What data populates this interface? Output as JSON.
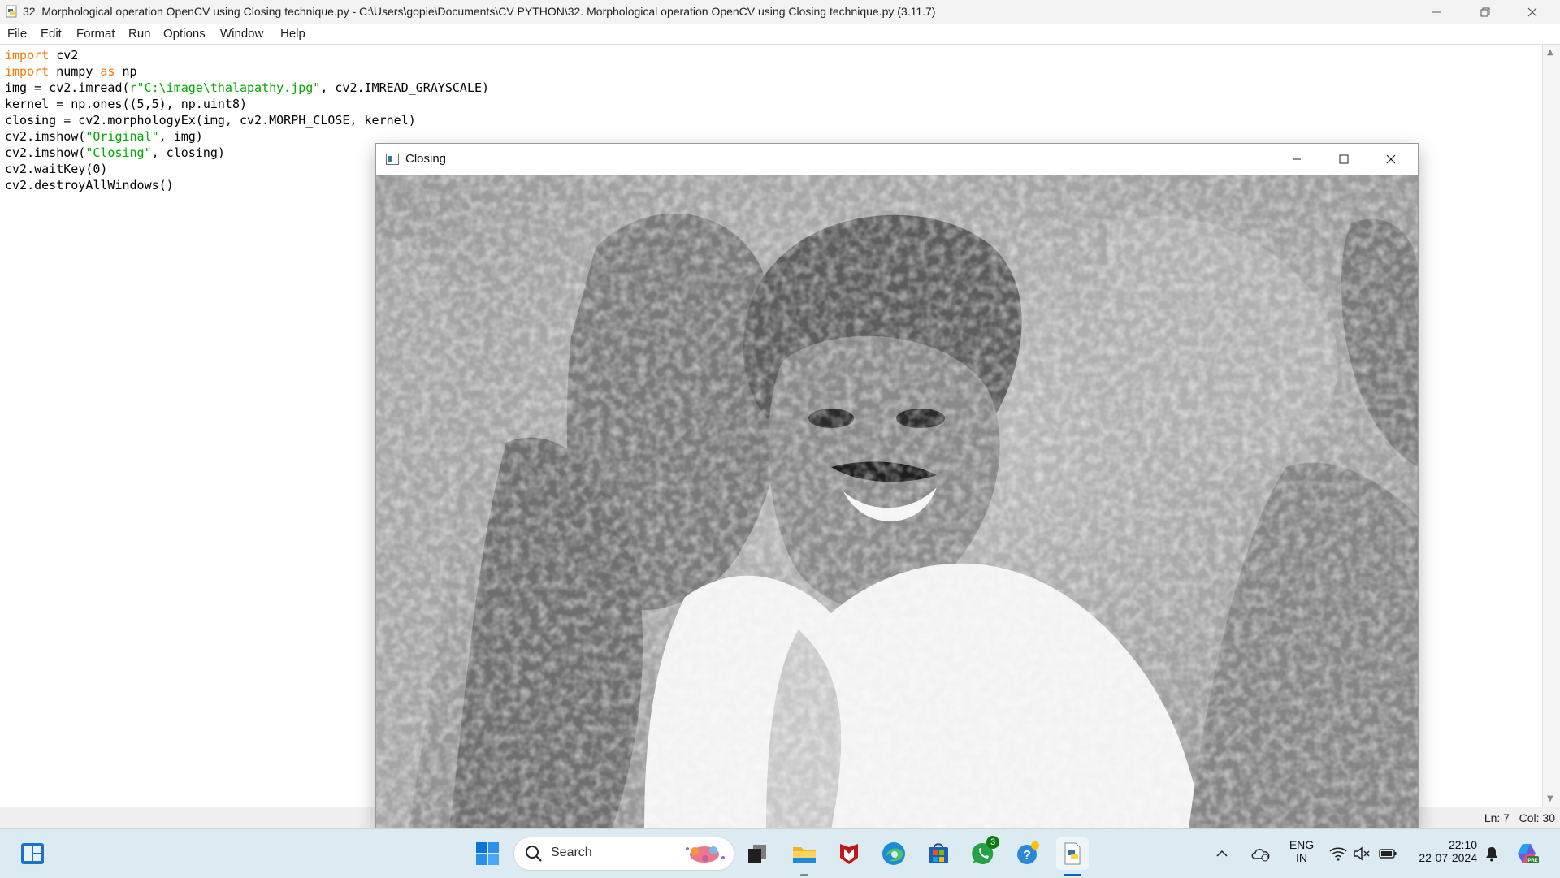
{
  "window": {
    "title": "32. Morphological operation OpenCV using Closing technique.py - C:\\Users\\gopie\\Documents\\CV PYTHON\\32. Morphological operation OpenCV using Closing technique.py (3.11.7)"
  },
  "menu": [
    "File",
    "Edit",
    "Format",
    "Run",
    "Options",
    "Window",
    "Help"
  ],
  "code_lines": [
    [
      {
        "t": "import",
        "c": "kw"
      },
      {
        "t": " cv2"
      }
    ],
    [
      {
        "t": "import",
        "c": "kw"
      },
      {
        "t": " numpy "
      },
      {
        "t": "as",
        "c": "kw"
      },
      {
        "t": " np"
      }
    ],
    [
      {
        "t": "img = cv2.imread("
      },
      {
        "t": "r\"C:\\image\\thalapathy.jpg\"",
        "c": "str"
      },
      {
        "t": ", cv2.IMREAD_GRAYSCALE)"
      }
    ],
    [
      {
        "t": "kernel = np.ones((5,5), np.uint8)"
      }
    ],
    [
      {
        "t": "closing = cv2.morphologyEx(img, cv2.MORPH_CLOSE, kernel)"
      }
    ],
    [
      {
        "t": "cv2.imshow("
      },
      {
        "t": "\"Original\"",
        "c": "str"
      },
      {
        "t": ", img)"
      }
    ],
    [
      {
        "t": "cv2.imshow("
      },
      {
        "t": "\"Closing\"",
        "c": "str"
      },
      {
        "t": ", closing)"
      }
    ],
    [
      {
        "t": "cv2.waitKey(0)"
      }
    ],
    [
      {
        "t": "cv2.destroyAllWindows()"
      }
    ]
  ],
  "status": {
    "position": "Ln: 7   Col: 30"
  },
  "closing_window": {
    "title": "Closing"
  },
  "taskbar": {
    "search_label": "Search",
    "language": "ENG",
    "region": "IN",
    "time": "22:10",
    "date": "22-07-2024",
    "whatsapp_badge": "3"
  },
  "colors": {
    "keyword": "#ff7700",
    "string": "#00aa00",
    "taskbar_bg": "#dceaf2",
    "accent": "#0067c0"
  },
  "icons": {
    "start": "windows-start-icon",
    "search": "search-icon",
    "taskview": "task-view-icon",
    "explorer": "file-explorer-icon",
    "mcafee": "mcafee-icon",
    "edge": "edge-icon",
    "store": "microsoft-store-icon",
    "whatsapp": "whatsapp-icon",
    "help": "get-help-icon",
    "python": "python-idle-icon",
    "copilot": "copilot-icon"
  }
}
